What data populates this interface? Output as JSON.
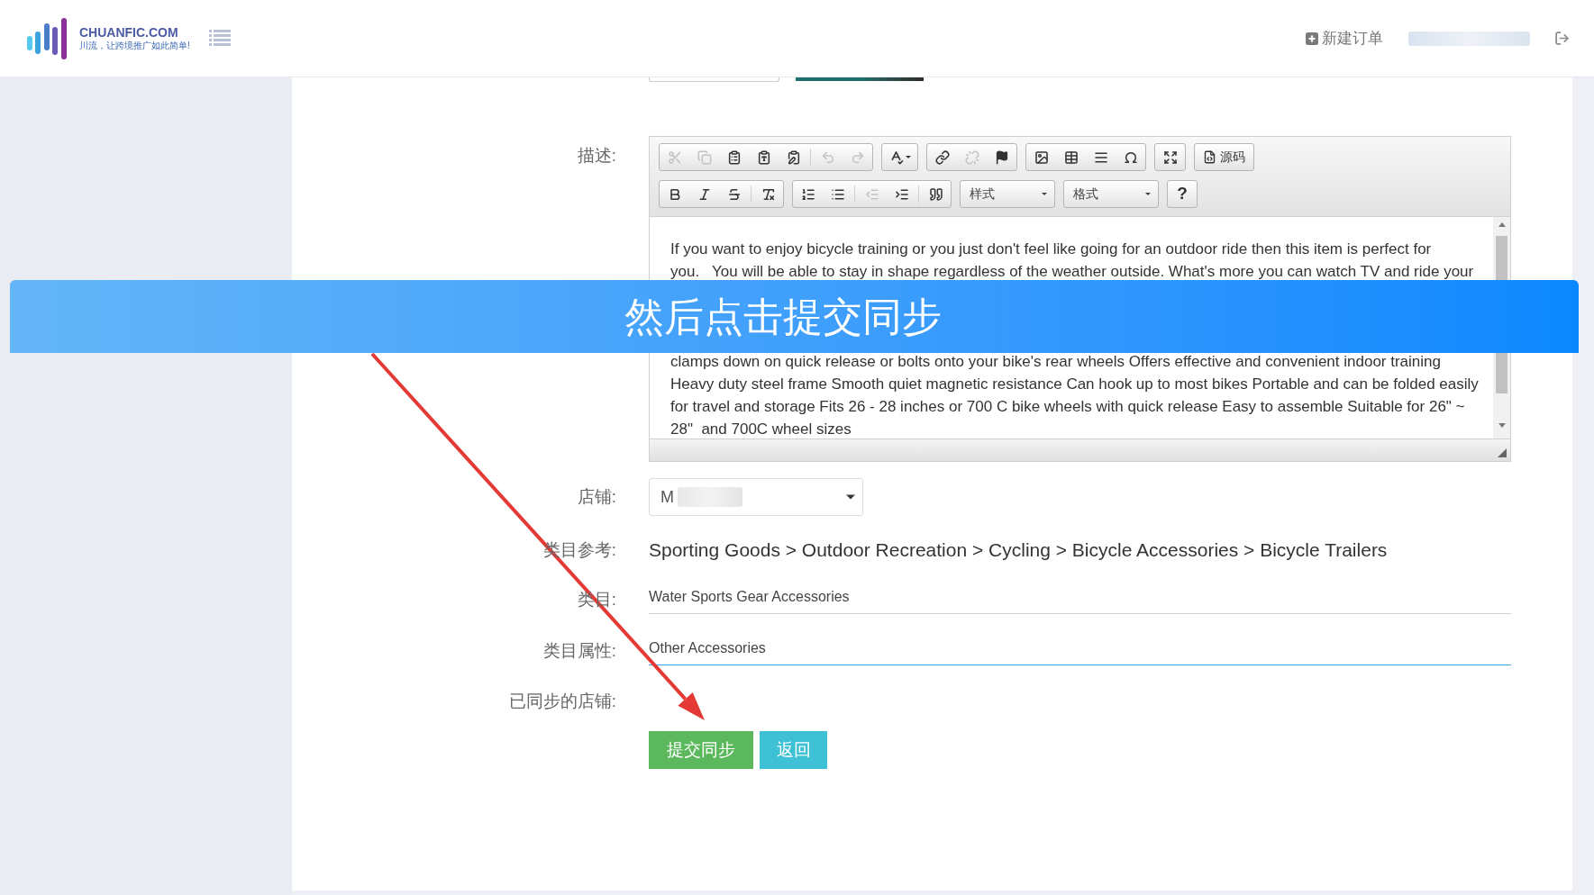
{
  "header": {
    "brand": "CHUANFIC.COM",
    "tagline": "川流，让跨境推广如此简单!",
    "new_order": "新建订单"
  },
  "form": {
    "description": {
      "label": "描述:",
      "toolbar": {
        "rows": [
          {
            "groups": [
              {
                "items": [
                  {
                    "kind": "icon",
                    "disabled": true
                  },
                  {
                    "kind": "icon",
                    "disabled": true
                  },
                  {
                    "kind": "icon",
                    "disabled": false
                  },
                  {
                    "kind": "icon",
                    "disabled": false
                  },
                  {
                    "kind": "icon",
                    "disabled": false
                  },
                  {
                    "kind": "separator"
                  },
                  {
                    "kind": "icon",
                    "disabled": true
                  },
                  {
                    "kind": "icon",
                    "disabled": true
                  }
                ]
              },
              {
                "items": [
                  {
                    "kind": "icon_dropdown",
                    "disabled": false
                  }
                ]
              },
              {
                "items": [
                  {
                    "kind": "icon",
                    "disabled": false
                  },
                  {
                    "kind": "icon",
                    "disabled": true
                  },
                  {
                    "kind": "icon",
                    "disabled": false
                  }
                ]
              },
              {
                "items": [
                  {
                    "kind": "icon",
                    "disabled": false
                  },
                  {
                    "kind": "icon",
                    "disabled": false
                  },
                  {
                    "kind": "icon",
                    "disabled": false
                  },
                  {
                    "kind": "icon",
                    "disabled": false
                  }
                ]
              },
              {
                "items": [
                  {
                    "kind": "icon",
                    "disabled": false
                  }
                ]
              },
              {
                "items": [
                  {
                    "kind": "icon_label",
                    "label": "源码",
                    "disabled": false
                  }
                ]
              }
            ]
          },
          {
            "groups": [
              {
                "items": [
                  {
                    "kind": "icon",
                    "disabled": false
                  },
                  {
                    "kind": "icon",
                    "disabled": false
                  },
                  {
                    "kind": "icon",
                    "disabled": false
                  },
                  {
                    "kind": "separator"
                  },
                  {
                    "kind": "icon",
                    "disabled": false
                  }
                ]
              },
              {
                "items": [
                  {
                    "kind": "icon",
                    "disabled": false
                  },
                  {
                    "kind": "icon",
                    "disabled": false
                  },
                  {
                    "kind": "separator"
                  },
                  {
                    "kind": "icon",
                    "disabled": true
                  },
                  {
                    "kind": "icon",
                    "disabled": false
                  },
                  {
                    "kind": "separator"
                  },
                  {
                    "kind": "icon",
                    "disabled": false
                  }
                ]
              },
              {
                "items": [
                  {
                    "kind": "combo",
                    "label": "样式"
                  }
                ]
              },
              {
                "items": [
                  {
                    "kind": "combo",
                    "label": "格式"
                  }
                ]
              },
              {
                "items": [
                  {
                    "kind": "text",
                    "label": "?",
                    "disabled": false
                  }
                ]
              }
            ]
          }
        ]
      },
      "text_lines_top": [
        "If you want to enjoy bicycle training or you just don't feel like going for an outdoor ride then this item is perfect for",
        "you.   You will be able to stay in shape regardless of the weather outside. What's more you can watch TV and ride your"
      ],
      "text_lines_bottom": [
        "clamps down on quick release or bolts onto your bike's rear wheels Offers effective and convenient indoor training",
        "Heavy duty steel frame Smooth quiet magnetic resistance Can hook up to most bikes Portable and can be folded easily",
        "for travel and storage Fits 26 - 28 inches or 700 C bike wheels with quick release Easy to assemble Suitable for 26\" ~",
        "28\"  and 700C wheel sizes"
      ]
    },
    "store": {
      "label": "店铺:",
      "value": "M"
    },
    "category_reference": {
      "label": "类目参考:",
      "path": "Sporting Goods > Outdoor Recreation > Cycling > Bicycle Accessories > Bicycle Trailers"
    },
    "category": {
      "label": "类目:",
      "value": "Water Sports Gear Accessories",
      "focused": false
    },
    "category_attribute": {
      "label": "类目属性:",
      "value": "Other Accessories",
      "focused": true
    },
    "synced_stores": {
      "label": "已同步的店铺:"
    },
    "buttons": [
      {
        "label": "提交同步",
        "kind": "primary"
      },
      {
        "label": "返回",
        "kind": "secondary"
      }
    ]
  },
  "overlay": {
    "banner": "然后点击提交同步"
  }
}
